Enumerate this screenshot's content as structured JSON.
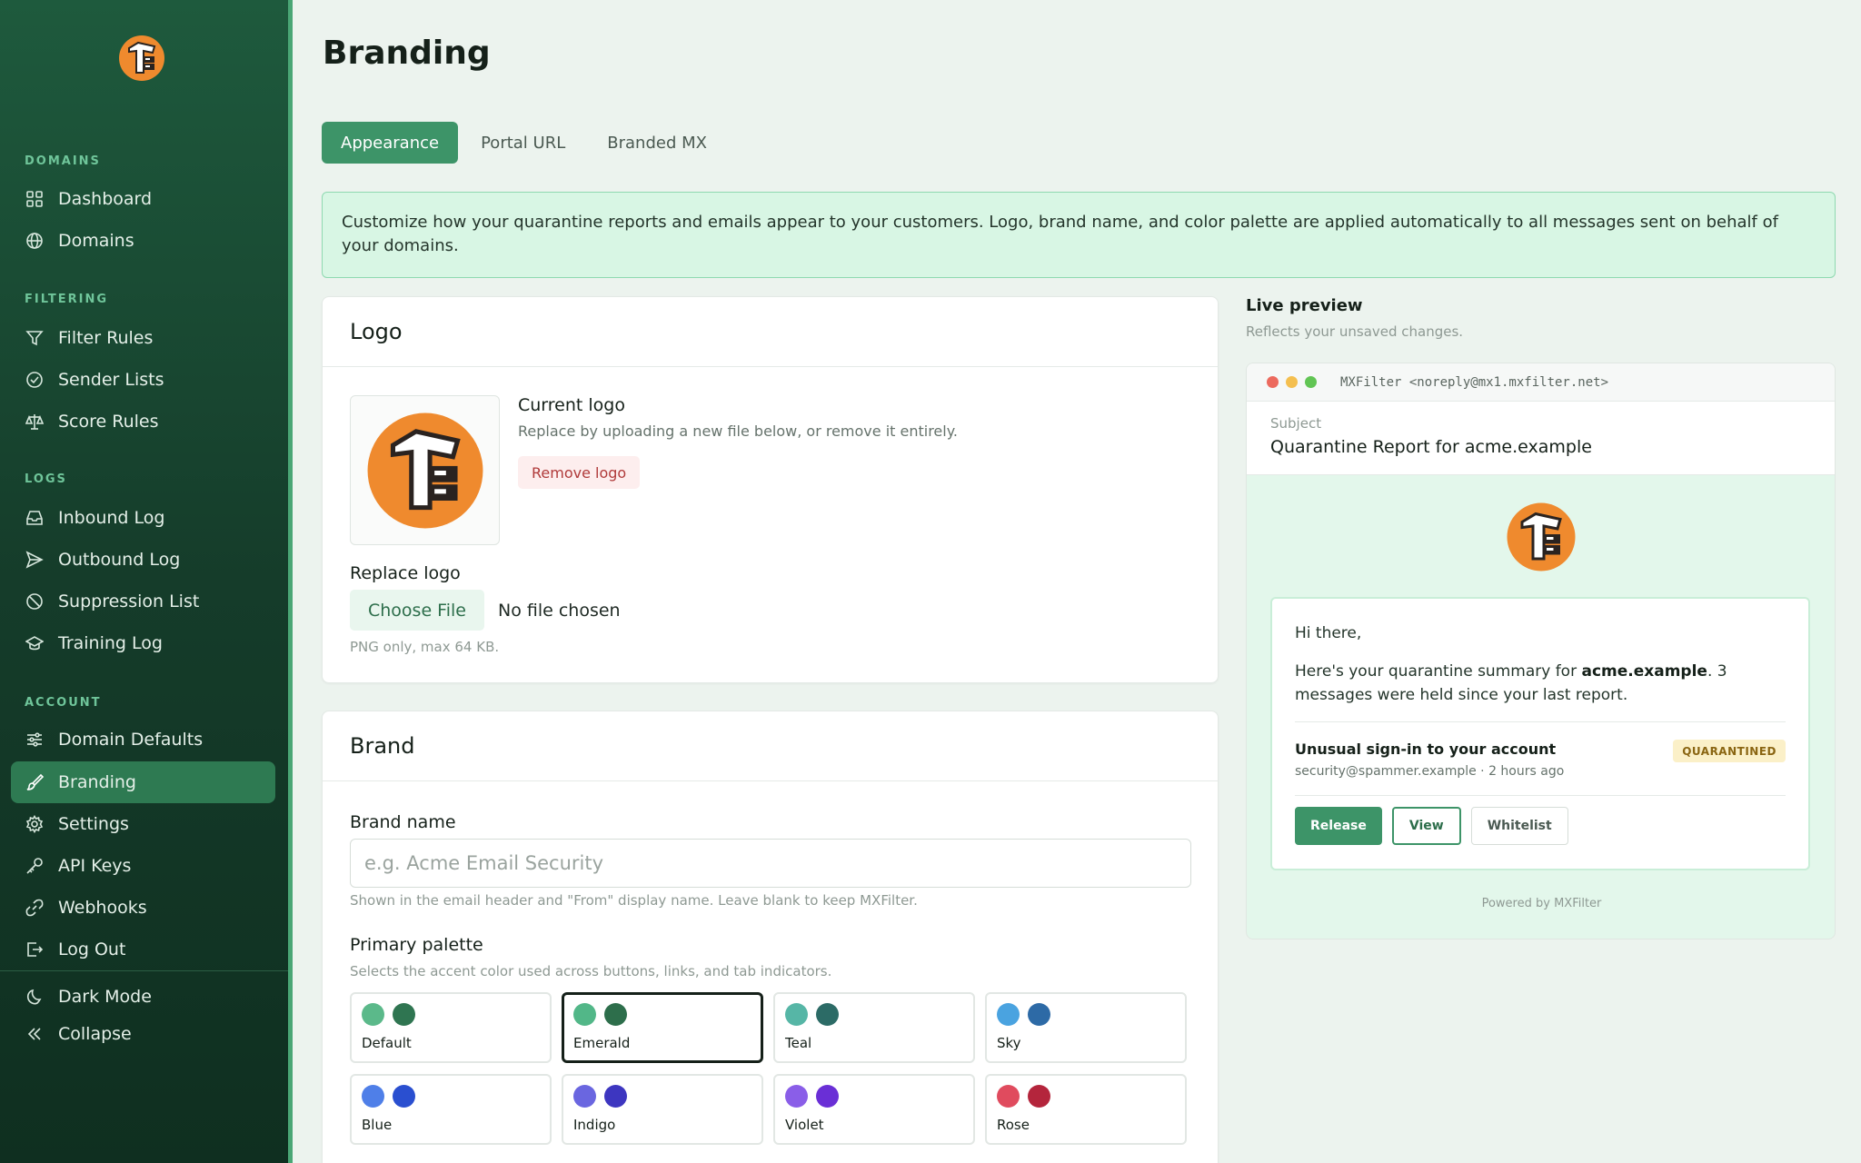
{
  "sidebar": {
    "sections": {
      "domains": "DOMAINS",
      "filtering": "FILTERING",
      "logs": "LOGS",
      "account": "ACCOUNT"
    },
    "items": {
      "dashboard": "Dashboard",
      "domains": "Domains",
      "filter_rules": "Filter Rules",
      "sender_lists": "Sender Lists",
      "score_rules": "Score Rules",
      "inbound_log": "Inbound Log",
      "outbound_log": "Outbound Log",
      "suppression_list": "Suppression List",
      "training_log": "Training Log",
      "domain_defaults": "Domain Defaults",
      "branding": "Branding",
      "settings": "Settings",
      "api_keys": "API Keys",
      "webhooks": "Webhooks",
      "log_out": "Log Out",
      "dark_mode": "Dark Mode",
      "collapse": "Collapse"
    },
    "active_item": "Branding"
  },
  "page": {
    "title": "Branding",
    "tabs": [
      "Appearance",
      "Portal URL",
      "Branded MX"
    ],
    "active_tab": "Appearance",
    "info": "Customize how your quarantine reports and emails appear to your customers. Logo, brand name, and color palette are applied automatically to all messages sent on behalf of your domains."
  },
  "logo_card": {
    "title": "Logo",
    "current_title": "Current logo",
    "current_desc": "Replace by uploading a new file below, or remove it entirely.",
    "remove_label": "Remove logo",
    "replace_title": "Replace logo",
    "choose_label": "Choose File",
    "no_file": "No file chosen",
    "hint": "PNG only, max 64 KB."
  },
  "brand_card": {
    "title": "Brand",
    "name_label": "Brand name",
    "name_placeholder": "e.g. Acme Email Security",
    "name_value": "",
    "name_hint": "Shown in the email header and \"From\" display name. Leave blank to keep MXFilter.",
    "palette_label": "Primary palette",
    "palette_hint": "Selects the accent color used across buttons, links, and tab indicators.",
    "selected_palette": "Emerald",
    "palettes": [
      {
        "name": "Default",
        "light": "#5bb98a",
        "dark": "#2f7551"
      },
      {
        "name": "Emerald",
        "light": "#52b788",
        "dark": "#2d6e4b"
      },
      {
        "name": "Teal",
        "light": "#56b6a6",
        "dark": "#2c6b66"
      },
      {
        "name": "Sky",
        "light": "#4aa3e0",
        "dark": "#2d6aa6"
      },
      {
        "name": "Blue",
        "light": "#4f7fe8",
        "dark": "#2a4fd0"
      },
      {
        "name": "Indigo",
        "light": "#6a66e0",
        "dark": "#3d36c0"
      },
      {
        "name": "Violet",
        "light": "#8a5ee8",
        "dark": "#6a2fd6"
      },
      {
        "name": "Rose",
        "light": "#e04b5e",
        "dark": "#b4253c"
      }
    ]
  },
  "preview": {
    "title": "Live preview",
    "subtitle": "Reflects your unsaved changes.",
    "from": "MXFilter <noreply@mx1.mxfilter.net>",
    "subject_label": "Subject",
    "subject": "Quarantine Report for acme.example",
    "greeting": "Hi there,",
    "summary_pre": "Here's your quarantine summary for ",
    "summary_domain": "acme.example",
    "summary_post": ". 3 messages were held since your last report.",
    "message": {
      "subject": "Unusual sign-in to your account",
      "meta": "security@spammer.example · 2 hours ago",
      "badge": "QUARANTINED"
    },
    "actions": {
      "release": "Release",
      "view": "View",
      "whitelist": "Whitelist"
    },
    "powered_by": "Powered by MXFilter"
  },
  "colors": {
    "accent": "#3d9468",
    "sidebar_bg": "#1e5a3d",
    "info_bg": "#d8f6e4",
    "badge_bg": "#fbf0c8"
  }
}
